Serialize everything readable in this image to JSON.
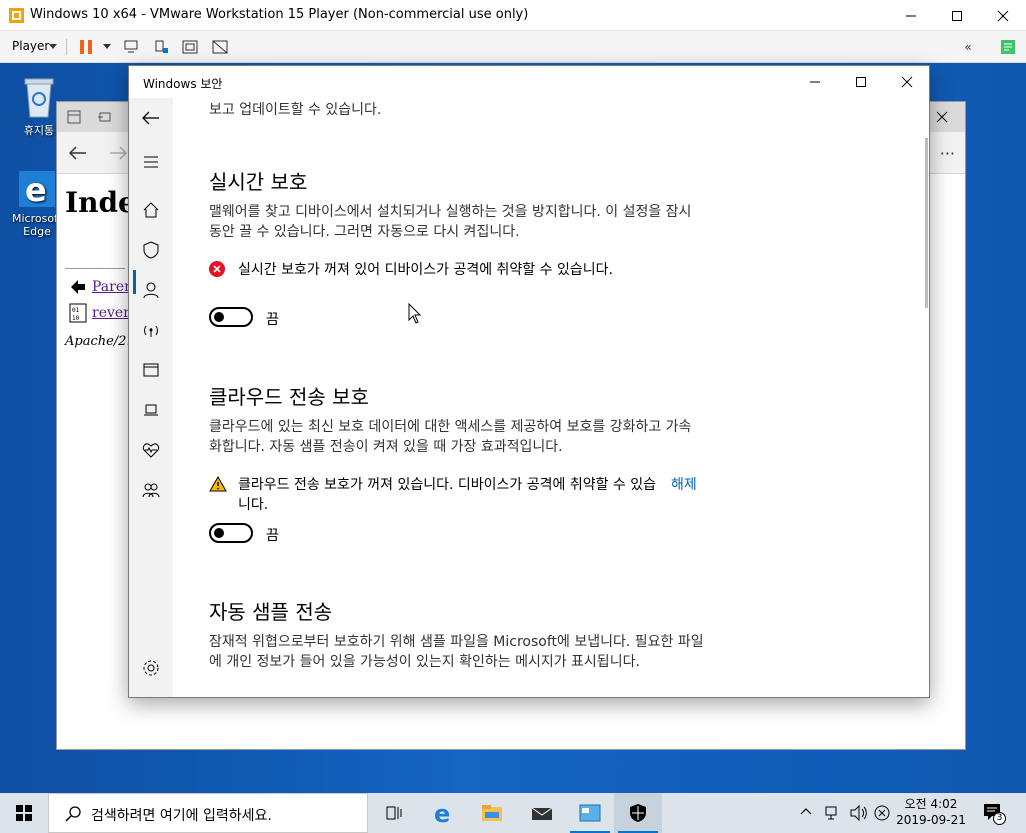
{
  "vmware": {
    "title": "Windows 10 x64 - VMware Workstation 15 Player (Non-commercial use only)",
    "player_label": "Player"
  },
  "desktop": {
    "recycle_label": "휴지통",
    "edge_label_line1": "Microsoft",
    "edge_label_line2": "Edge"
  },
  "edge_window": {
    "heading": "Index of /",
    "link1": "Parent Directory",
    "link2": "reverse",
    "footer": "Apache/2."
  },
  "security": {
    "title": "Windows 보안",
    "top_text": "보고 업데이트할 수 있습니다.",
    "realtime": {
      "heading": "실시간 보호",
      "desc": "맬웨어를 찾고 디바이스에서 설치되거나 실행하는 것을 방지합니다. 이 설정을 잠시 동안 끌 수 있습니다. 그러면 자동으로 다시 켜집니다.",
      "warning": "실시간 보호가 꺼져 있어 디바이스가 공격에 취약할 수 있습니다.",
      "toggle_label": "끔"
    },
    "cloud": {
      "heading": "클라우드 전송 보호",
      "desc": "클라우드에 있는 최신 보호 데이터에 대한 액세스를 제공하여 보호를 강화하고 가속화합니다. 자동 샘플 전송이 켜져 있을 때 가장 효과적입니다.",
      "warning": "클라우드 전송 보호가 꺼져 있습니다. 디바이스가 공격에 취약할 수 있습니다.",
      "dismiss": "해제",
      "toggle_label": "끔"
    },
    "sample": {
      "heading": "자동 샘플 전송",
      "desc": "잠재적 위협으로부터 보호하기 위해 샘플 파일을 Microsoft에 보냅니다. 필요한 파일에 개인 정보가 들어 있을 가능성이 있는지 확인하는 메시지가 표시됩니다."
    }
  },
  "taskbar": {
    "search_placeholder": "검색하려면 여기에 입력하세요.",
    "time": "오전 4:02",
    "date": "2019-09-21",
    "notification_count": "3"
  },
  "colors": {
    "accent": "#0063b1",
    "error": "#e81123",
    "warning": "#ffb900"
  }
}
